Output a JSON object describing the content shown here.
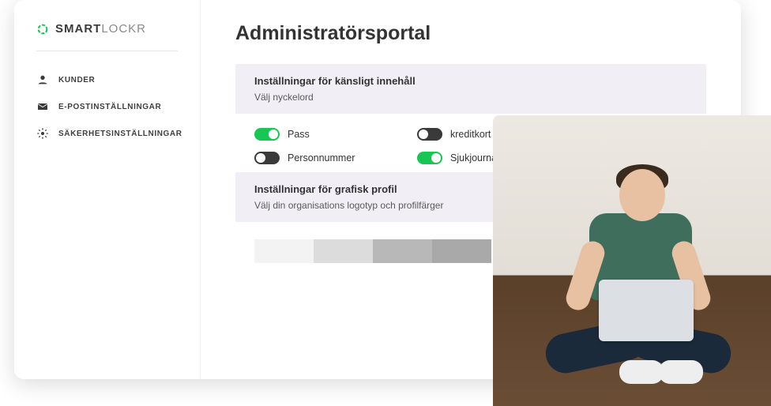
{
  "brand": {
    "strong": "SMART",
    "light": "LOCKR"
  },
  "sidebar": {
    "items": [
      {
        "label": "KUNDER"
      },
      {
        "label": "E-POSTINSTÄLLNINGAR"
      },
      {
        "label": "SÄKERHETSINSTÄLLNINGAR"
      }
    ]
  },
  "page": {
    "title": "Administratörsportal"
  },
  "panels": {
    "sensitive": {
      "title": "Inställningar för känsligt innehåll",
      "sub": "Välj nyckelord"
    },
    "profile": {
      "title": "Inställningar för grafisk profil",
      "sub": "Välj din organisations logotyp och profilfärger"
    }
  },
  "toggles": [
    {
      "label": "Pass",
      "on": true
    },
    {
      "label": "kreditkort",
      "on": false
    },
    {
      "label": "Personnummer",
      "on": false
    },
    {
      "label": "Sjukjournal",
      "on": true
    }
  ],
  "colors": {
    "accent_on": "#17c653",
    "accent_off": "#3a3a3a"
  },
  "swatches": [
    "#f3f3f3",
    "#dcdcdc",
    "#b8b8b8",
    "#a9a9a9"
  ]
}
